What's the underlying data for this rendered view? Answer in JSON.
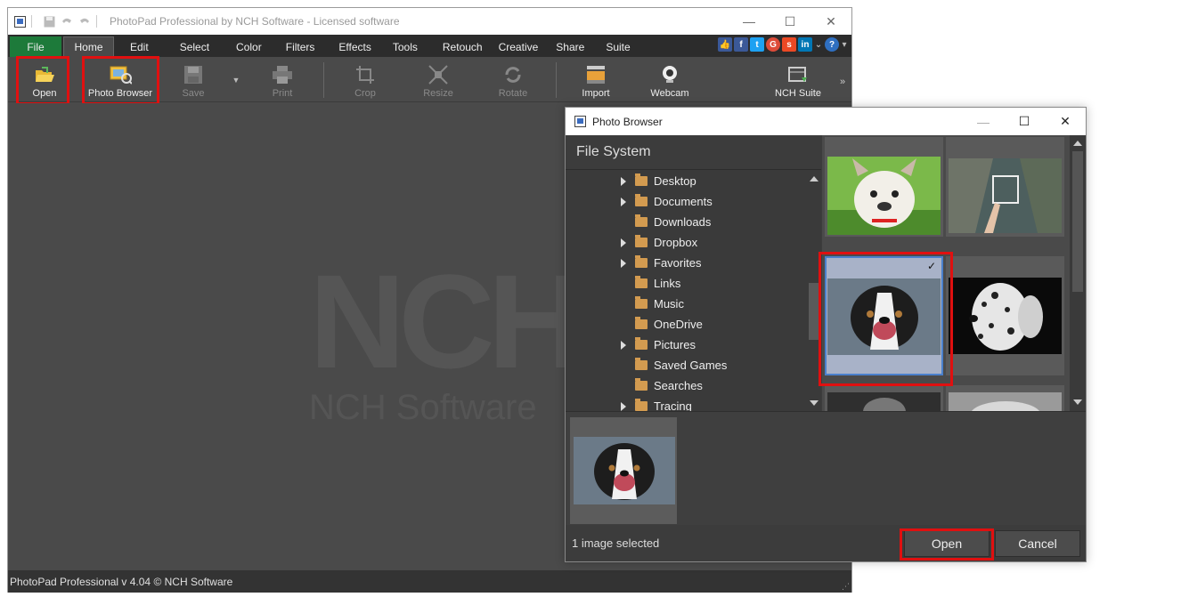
{
  "app": {
    "title": "PhotoPad Professional by NCH Software - Licensed software",
    "menu": [
      "File",
      "Home",
      "Edit",
      "Select",
      "Color",
      "Filters",
      "Effects",
      "Tools",
      "Retouch",
      "Creative",
      "Share",
      "Suite"
    ],
    "active_tab": "Home",
    "toolbar": {
      "open": "Open",
      "photo_browser": "Photo Browser",
      "save": "Save",
      "print": "Print",
      "crop": "Crop",
      "resize": "Resize",
      "rotate": "Rotate",
      "import": "Import",
      "webcam": "Webcam",
      "nch_suite": "NCH Suite",
      "more": "»"
    },
    "watermark": {
      "logo": "NCH",
      "reg": "®",
      "sub": "NCH Software"
    },
    "status": "PhotoPad Professional v 4.04 © NCH Software",
    "colors": {
      "file_tab": "#1d7a3a",
      "highlight": "#e01010"
    }
  },
  "dialog": {
    "title": "Photo Browser",
    "panel_header": "File System",
    "folders": [
      {
        "label": "Desktop",
        "expandable": true
      },
      {
        "label": "Documents",
        "expandable": true
      },
      {
        "label": "Downloads",
        "expandable": false
      },
      {
        "label": "Dropbox",
        "expandable": true
      },
      {
        "label": "Favorites",
        "expandable": true
      },
      {
        "label": "Links",
        "expandable": false
      },
      {
        "label": "Music",
        "expandable": false
      },
      {
        "label": "OneDrive",
        "expandable": false
      },
      {
        "label": "Pictures",
        "expandable": true
      },
      {
        "label": "Saved Games",
        "expandable": false
      },
      {
        "label": "Searches",
        "expandable": false
      },
      {
        "label": "Tracing",
        "expandable": true
      }
    ],
    "thumbnails": [
      "bulldog",
      "lake-frame",
      "collie-dog",
      "dalmatian",
      "dog-partial-1",
      "dog-partial-2"
    ],
    "selected_thumbnail": "collie-dog",
    "selected_count_text": "1 image selected",
    "buttons": {
      "open": "Open",
      "cancel": "Cancel"
    },
    "check": "✓"
  }
}
